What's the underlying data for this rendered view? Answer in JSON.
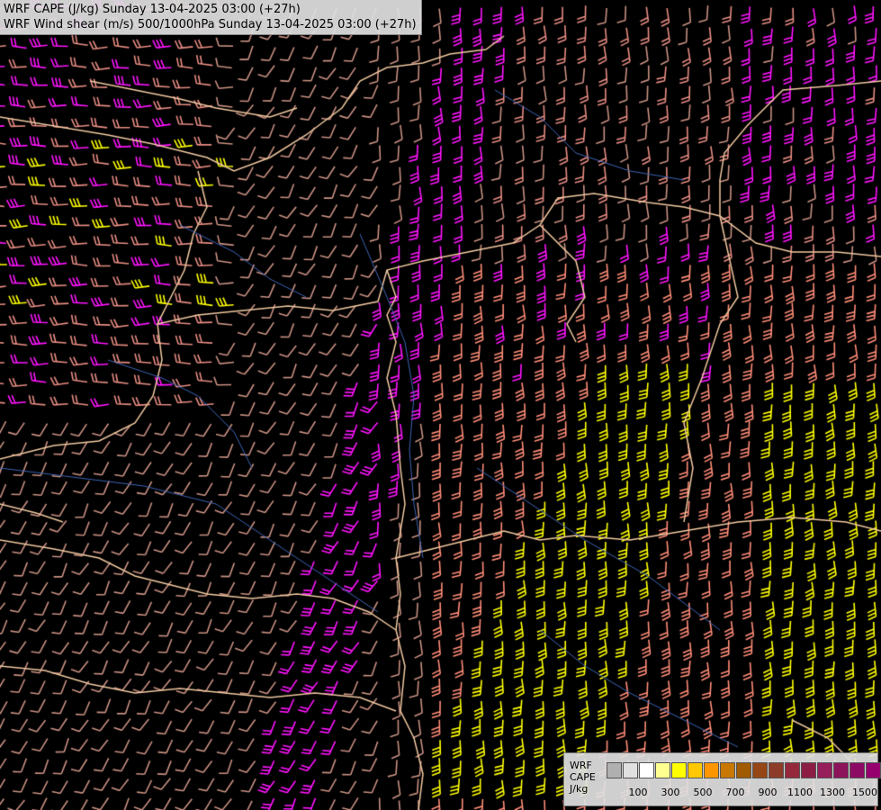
{
  "header": {
    "line1": "WRF CAPE (J/kg) Sunday 13-04-2025 03:00 (+27h)",
    "line2": "WRF Wind shear (m/s) 500/1000hPa Sunday 13-04-2025 03:00 (+27h)"
  },
  "legend": {
    "title_lines": [
      "WRF",
      "CAPE",
      "J/kg"
    ],
    "swatch_colors": [
      "#b0b0b0",
      "#e0e0e0",
      "#ffffff",
      "#fffe90",
      "#ffff00",
      "#ffc800",
      "#ff9600",
      "#c87800",
      "#a05a00",
      "#964614",
      "#8c3c28",
      "#96283c",
      "#8c1e46",
      "#961e5a",
      "#8c145a",
      "#8c0a64",
      "#96006e",
      "#8c0078",
      "#a00082"
    ],
    "tick_labels": [
      {
        "label": "100",
        "index": 1
      },
      {
        "label": "300",
        "index": 3
      },
      {
        "label": "500",
        "index": 5
      },
      {
        "label": "700",
        "index": 7
      },
      {
        "label": "900",
        "index": 9
      },
      {
        "label": "1100",
        "index": 11
      },
      {
        "label": "1300",
        "index": 13
      },
      {
        "label": "1500",
        "index": 15
      }
    ]
  },
  "map": {
    "barb_colors": {
      "light_brown": "#c89082",
      "pink": "#e68c82",
      "salmon": "#ff8c78",
      "magenta": "#ff14ff",
      "yellow": "#ffff00"
    },
    "border_color": "#f0c8a0",
    "river_color": "#3c64b4"
  }
}
